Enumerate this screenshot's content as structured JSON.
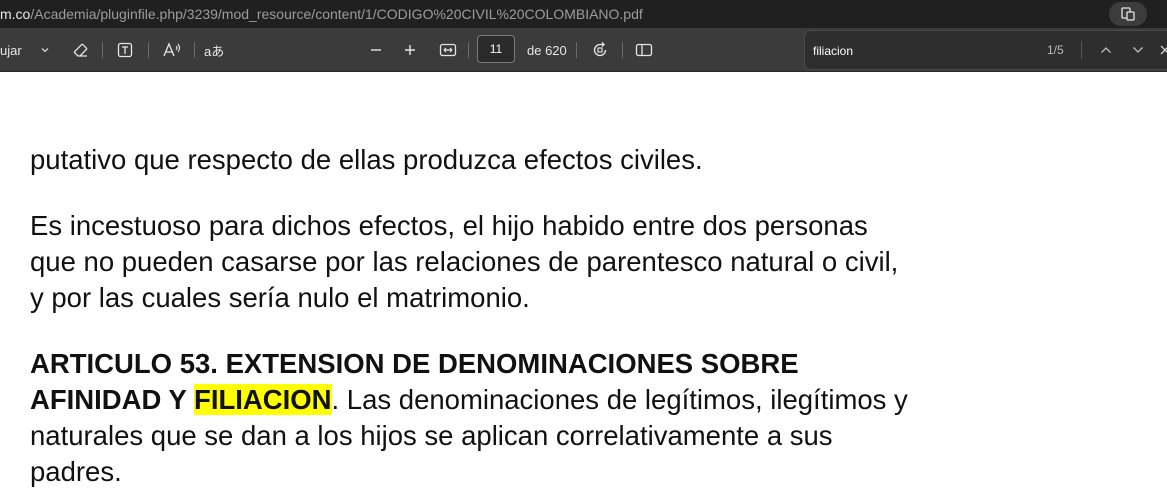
{
  "browser": {
    "url_host": "m.co",
    "url_path": "/Academia/pluginfile.php/3239/mod_resource/content/1/CODIGO%20CIVIL%20COLOMBIANO.pdf"
  },
  "toolbar": {
    "draw_label": "ujar",
    "aa_label": "aあ",
    "page_current": "11",
    "page_total_label": "de 620"
  },
  "find": {
    "query": "filiacion",
    "count": "1/5"
  },
  "document": {
    "p1_line1": "putativo que respecto de ellas produzca efectos civiles.",
    "p2_line1": "Es incestuoso para dichos efectos, el hijo habido entre dos personas",
    "p2_line2": "que no pueden casarse por las relaciones de parentesco natural o civil,",
    "p2_line3": "y por las cuales sería nulo el matrimonio.",
    "p3_line1": "ARTICULO 53. EXTENSION DE DENOMINACIONES SOBRE",
    "p3_line2_bold": "AFINIDAD Y ",
    "p3_line2_highlight": "FILIACION",
    "p3_line2_rest": ". Las denominaciones de legítimos, ilegítimos y",
    "p3_line3": "naturales que se dan a los hijos se aplican correlativamente a sus",
    "p3_line4": "padres."
  },
  "colors": {
    "highlight": "#ffff00",
    "toolbar_bg": "#3b3b3b",
    "urlbar_bg": "#202020"
  },
  "icons": [
    "chevron-down-icon",
    "eraser-icon",
    "text-box-icon",
    "read-aloud-icon",
    "zoom-out-icon",
    "zoom-in-icon",
    "fit-width-icon",
    "rotate-icon",
    "page-view-icon",
    "find-up-icon",
    "find-down-icon",
    "close-icon",
    "extension-icon"
  ]
}
